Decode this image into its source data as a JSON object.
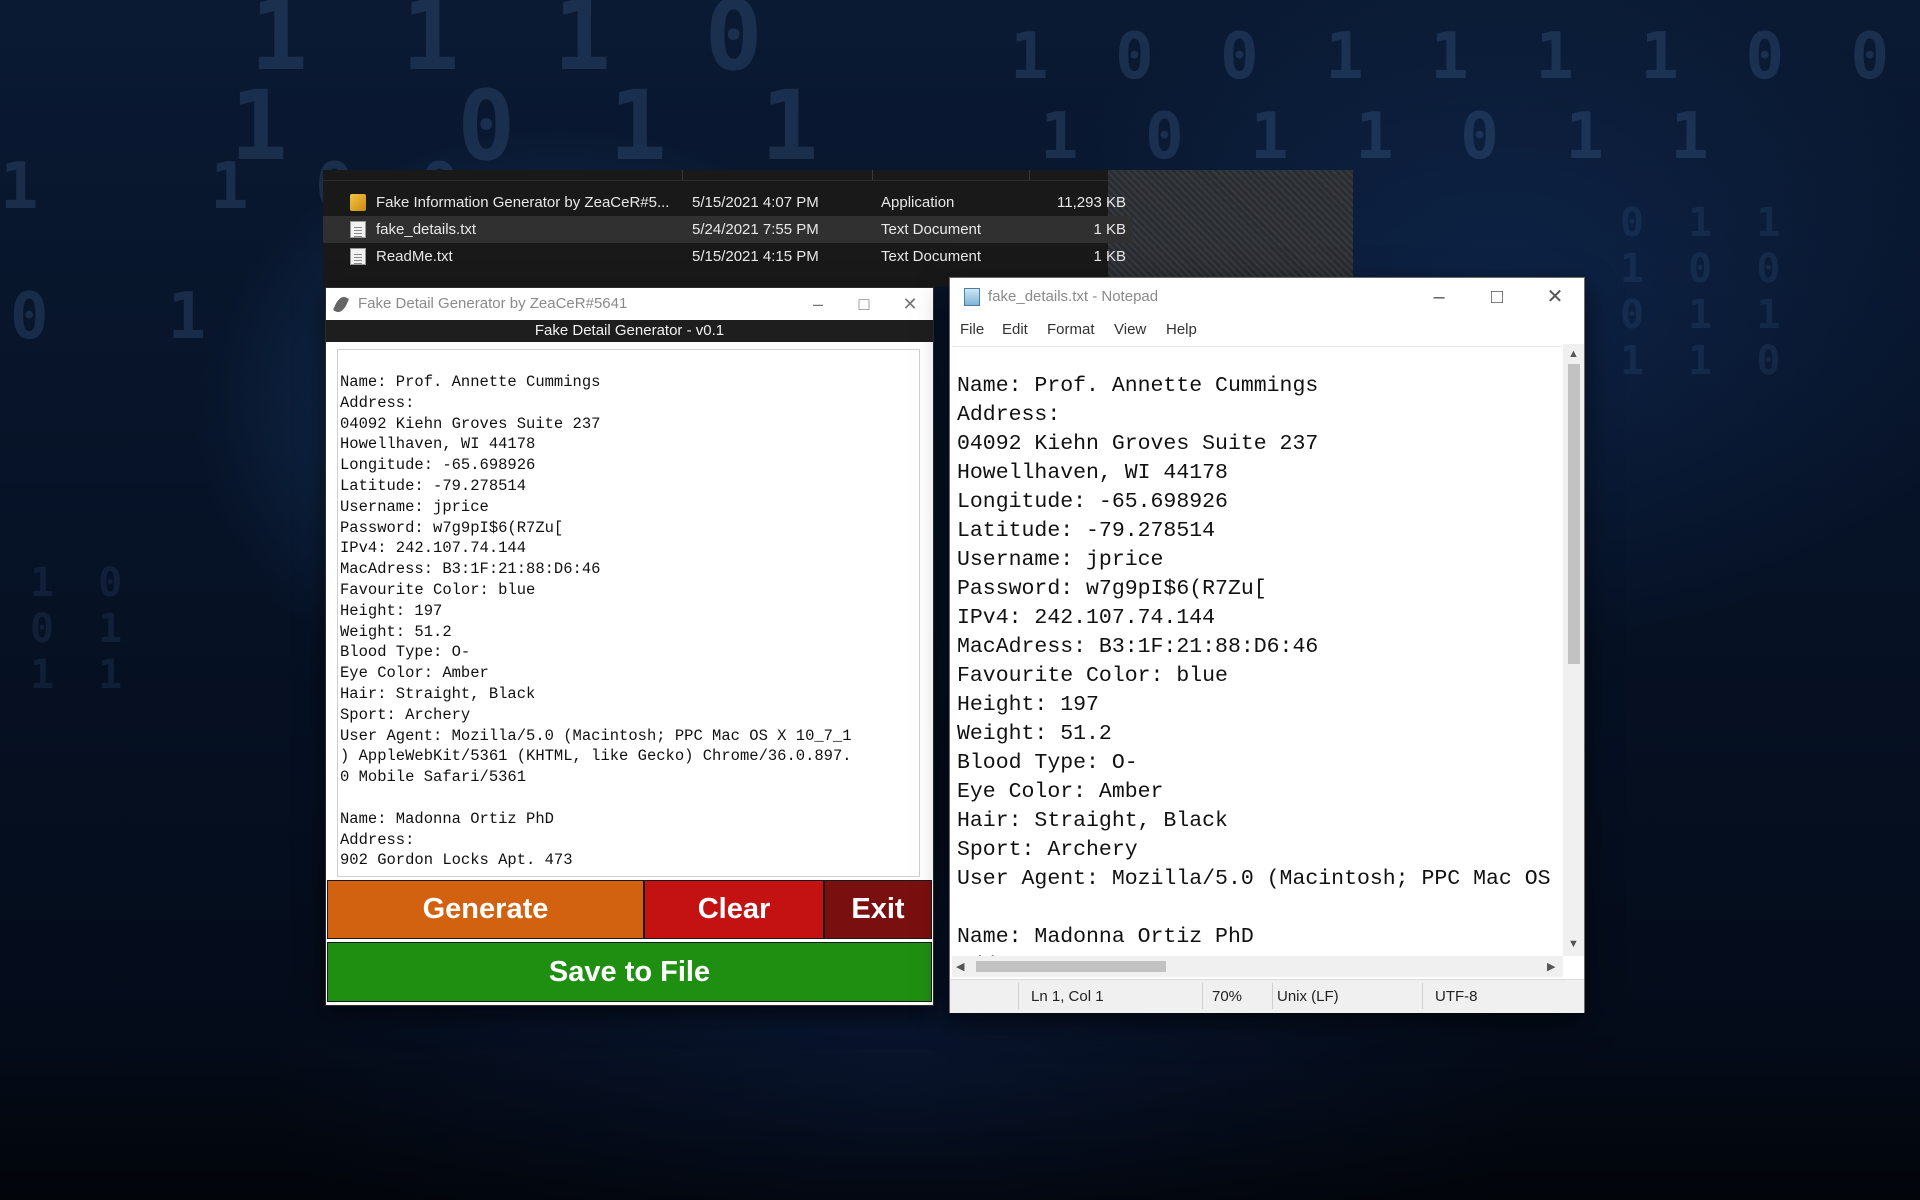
{
  "explorer": {
    "files": [
      {
        "name": "Fake Information Generator by ZeaCeR#5...",
        "date": "5/15/2021 4:07 PM",
        "type": "Application",
        "size": "11,293 KB",
        "icon": "application-icon"
      },
      {
        "name": "fake_details.txt",
        "date": "5/24/2021 7:55 PM",
        "type": "Text Document",
        "size": "1 KB",
        "icon": "text-file-icon"
      },
      {
        "name": "ReadMe.txt",
        "date": "5/15/2021 4:15 PM",
        "type": "Text Document",
        "size": "1 KB",
        "icon": "text-file-icon"
      }
    ]
  },
  "generator": {
    "window_title": "Fake Detail Generator by ZeaCeR#5641",
    "header": "Fake Detail Generator - v0.1",
    "output_text": "Name: Prof. Annette Cummings\nAddress:\n04092 Kiehn Groves Suite 237\nHowellhaven, WI 44178\nLongitude: -65.698926\nLatitude: -79.278514\nUsername: jprice\nPassword: w7g9pI$6(R7Zu[\nIPv4: 242.107.74.144\nMacAdress: B3:1F:21:88:D6:46\nFavourite Color: blue\nHeight: 197\nWeight: 51.2\nBlood Type: O-\nEye Color: Amber\nHair: Straight, Black\nSport: Archery\nUser Agent: Mozilla/5.0 (Macintosh; PPC Mac OS X 10_7_1\n) AppleWebKit/5361 (KHTML, like Gecko) Chrome/36.0.897.\n0 Mobile Safari/5361\n\nName: Madonna Ortiz PhD\nAddress:\n902 Gordon Locks Apt. 473",
    "buttons": {
      "generate": "Generate",
      "clear": "Clear",
      "exit": "Exit",
      "save": "Save to File"
    },
    "colors": {
      "generate": "#d2620f",
      "clear": "#c41212",
      "exit": "#7a0f0f",
      "save": "#1f8f12"
    }
  },
  "notepad": {
    "window_title": "fake_details.txt - Notepad",
    "menu": [
      "File",
      "Edit",
      "Format",
      "View",
      "Help"
    ],
    "text": "Name: Prof. Annette Cummings\nAddress:\n04092 Kiehn Groves Suite 237\nHowellhaven, WI 44178\nLongitude: -65.698926\nLatitude: -79.278514\nUsername: jprice\nPassword: w7g9pI$6(R7Zu[\nIPv4: 242.107.74.144\nMacAdress: B3:1F:21:88:D6:46\nFavourite Color: blue\nHeight: 197\nWeight: 51.2\nBlood Type: O-\nEye Color: Amber\nHair: Straight, Black\nSport: Archery\nUser Agent: Mozilla/5.0 (Macintosh; PPC Mac OS\n\nName: Madonna Ortiz PhD\nAddress:",
    "status": {
      "position": "Ln 1, Col 1",
      "zoom": "70%",
      "line_ending": "Unix (LF)",
      "encoding": "UTF-8"
    }
  }
}
